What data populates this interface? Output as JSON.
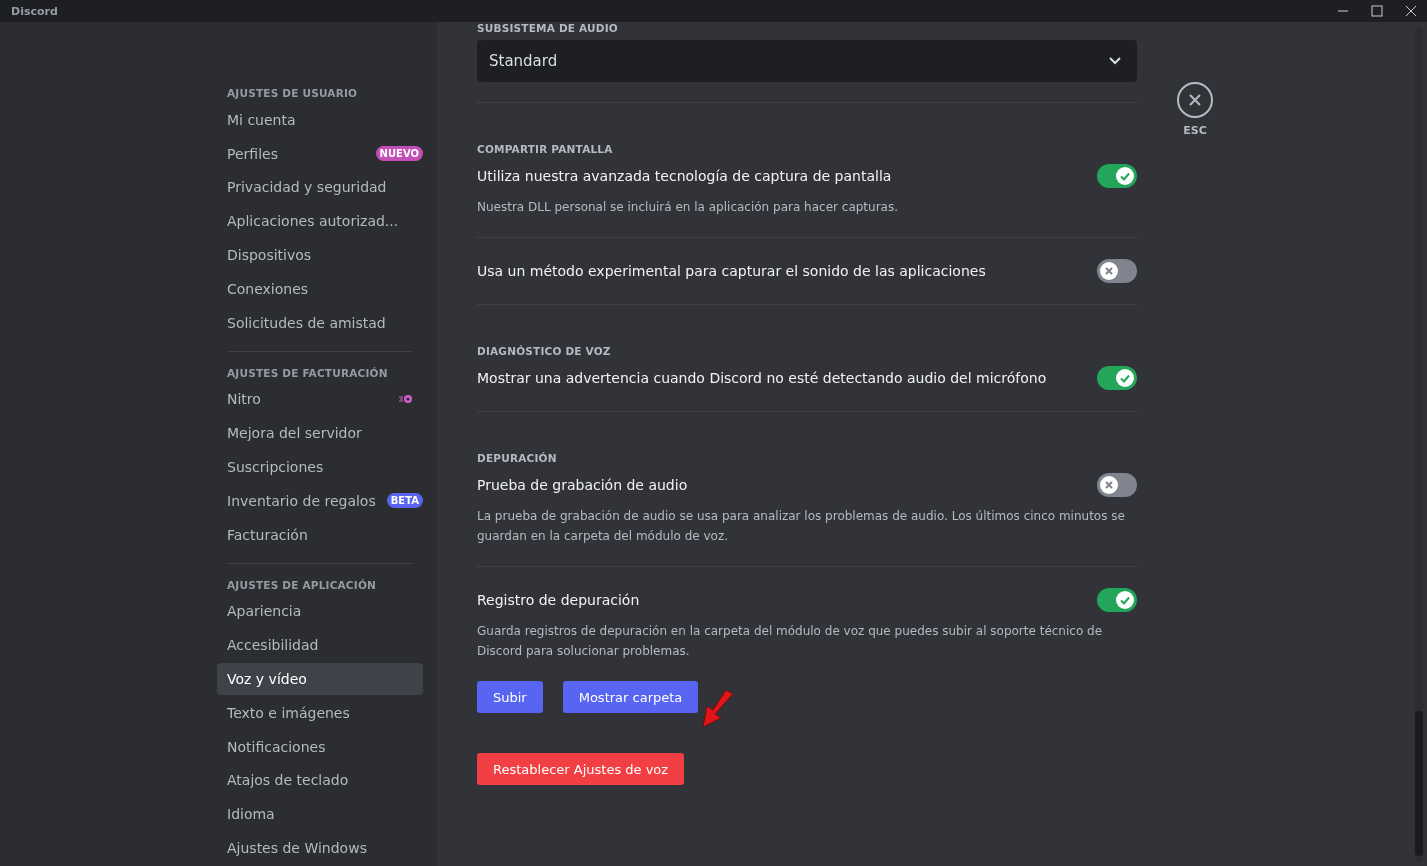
{
  "window": {
    "title": "Discord"
  },
  "sidebar": {
    "groups": [
      {
        "heading": "AJUSTES DE USUARIO",
        "items": [
          {
            "label": "Mi cuenta",
            "selected": false
          },
          {
            "label": "Perfiles",
            "selected": false,
            "badge": {
              "text": "NUEVO",
              "color": "#c54db6"
            }
          },
          {
            "label": "Privacidad y seguridad",
            "selected": false
          },
          {
            "label": "Aplicaciones autorizad...",
            "selected": false
          },
          {
            "label": "Dispositivos",
            "selected": false
          },
          {
            "label": "Conexiones",
            "selected": false
          },
          {
            "label": "Solicitudes de amistad",
            "selected": false
          }
        ]
      },
      {
        "heading": "AJUSTES DE FACTURACIÓN",
        "items": [
          {
            "label": "Nitro",
            "selected": false,
            "kind": "nitro"
          },
          {
            "label": "Mejora del servidor",
            "selected": false
          },
          {
            "label": "Suscripciones",
            "selected": false
          },
          {
            "label": "Inventario de regalos",
            "selected": false,
            "badge": {
              "text": "BETA",
              "color": "#5865f2"
            }
          },
          {
            "label": "Facturación",
            "selected": false
          }
        ]
      },
      {
        "heading": "AJUSTES DE APLICACIÓN",
        "items": [
          {
            "label": "Apariencia",
            "selected": false
          },
          {
            "label": "Accesibilidad",
            "selected": false
          },
          {
            "label": "Voz y vídeo",
            "selected": true
          },
          {
            "label": "Texto e imágenes",
            "selected": false
          },
          {
            "label": "Notificaciones",
            "selected": false
          },
          {
            "label": "Atajos de teclado",
            "selected": false
          },
          {
            "label": "Idioma",
            "selected": false
          },
          {
            "label": "Ajustes de Windows",
            "selected": false
          }
        ]
      }
    ]
  },
  "content": {
    "blocks": [
      {
        "kind": "header",
        "text": "SUBSISTEMA DE AUDIO"
      },
      {
        "kind": "select",
        "value": "Standard"
      },
      {
        "kind": "divider"
      },
      {
        "kind": "header",
        "text": "COMPARTIR PANTALLA"
      },
      {
        "kind": "toggle",
        "title": "Utiliza nuestra avanzada tecnología de captura de pantalla",
        "on": true,
        "description": "Nuestra DLL personal se incluirá en la aplicación para hacer capturas."
      },
      {
        "kind": "divider"
      },
      {
        "kind": "toggle",
        "title": "Usa un método experimental para capturar el sonido de las aplicaciones",
        "on": false
      },
      {
        "kind": "divider"
      },
      {
        "kind": "header",
        "text": "DIAGNÓSTICO DE VOZ"
      },
      {
        "kind": "toggle",
        "title": "Mostrar una advertencia cuando Discord no esté detectando audio del micrófono",
        "on": true
      },
      {
        "kind": "divider"
      },
      {
        "kind": "header",
        "text": "DEPURACIÓN"
      },
      {
        "kind": "toggle",
        "title": "Prueba de grabación de audio",
        "on": false,
        "description": "La prueba de grabación de audio se usa para analizar los problemas de audio. Los últimos cinco minutos se guardan en la carpeta del módulo de voz."
      },
      {
        "kind": "divider"
      },
      {
        "kind": "toggle",
        "title": "Registro de depuración",
        "on": true,
        "description": "Guarda registros de depuración en la carpeta del módulo de voz que puedes subir al soporte técnico de Discord para solucionar problemas."
      },
      {
        "kind": "buttons",
        "labels": [
          "Subir",
          "Mostrar carpeta"
        ]
      },
      {
        "kind": "danger",
        "label": "Restablecer Ajustes de voz"
      }
    ]
  },
  "close": {
    "label": "ESC"
  },
  "annotation": {
    "kind": "arrow"
  }
}
